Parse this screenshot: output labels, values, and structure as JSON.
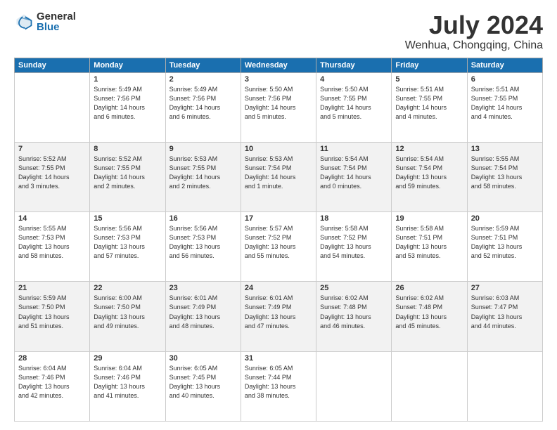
{
  "header": {
    "logo_general": "General",
    "logo_blue": "Blue",
    "month_title": "July 2024",
    "location": "Wenhua, Chongqing, China"
  },
  "days_of_week": [
    "Sunday",
    "Monday",
    "Tuesday",
    "Wednesday",
    "Thursday",
    "Friday",
    "Saturday"
  ],
  "weeks": [
    [
      {
        "day": "",
        "detail": ""
      },
      {
        "day": "1",
        "detail": "Sunrise: 5:49 AM\nSunset: 7:56 PM\nDaylight: 14 hours\nand 6 minutes."
      },
      {
        "day": "2",
        "detail": "Sunrise: 5:49 AM\nSunset: 7:56 PM\nDaylight: 14 hours\nand 6 minutes."
      },
      {
        "day": "3",
        "detail": "Sunrise: 5:50 AM\nSunset: 7:56 PM\nDaylight: 14 hours\nand 5 minutes."
      },
      {
        "day": "4",
        "detail": "Sunrise: 5:50 AM\nSunset: 7:55 PM\nDaylight: 14 hours\nand 5 minutes."
      },
      {
        "day": "5",
        "detail": "Sunrise: 5:51 AM\nSunset: 7:55 PM\nDaylight: 14 hours\nand 4 minutes."
      },
      {
        "day": "6",
        "detail": "Sunrise: 5:51 AM\nSunset: 7:55 PM\nDaylight: 14 hours\nand 4 minutes."
      }
    ],
    [
      {
        "day": "7",
        "detail": "Sunrise: 5:52 AM\nSunset: 7:55 PM\nDaylight: 14 hours\nand 3 minutes."
      },
      {
        "day": "8",
        "detail": "Sunrise: 5:52 AM\nSunset: 7:55 PM\nDaylight: 14 hours\nand 2 minutes."
      },
      {
        "day": "9",
        "detail": "Sunrise: 5:53 AM\nSunset: 7:55 PM\nDaylight: 14 hours\nand 2 minutes."
      },
      {
        "day": "10",
        "detail": "Sunrise: 5:53 AM\nSunset: 7:54 PM\nDaylight: 14 hours\nand 1 minute."
      },
      {
        "day": "11",
        "detail": "Sunrise: 5:54 AM\nSunset: 7:54 PM\nDaylight: 14 hours\nand 0 minutes."
      },
      {
        "day": "12",
        "detail": "Sunrise: 5:54 AM\nSunset: 7:54 PM\nDaylight: 13 hours\nand 59 minutes."
      },
      {
        "day": "13",
        "detail": "Sunrise: 5:55 AM\nSunset: 7:54 PM\nDaylight: 13 hours\nand 58 minutes."
      }
    ],
    [
      {
        "day": "14",
        "detail": "Sunrise: 5:55 AM\nSunset: 7:53 PM\nDaylight: 13 hours\nand 58 minutes."
      },
      {
        "day": "15",
        "detail": "Sunrise: 5:56 AM\nSunset: 7:53 PM\nDaylight: 13 hours\nand 57 minutes."
      },
      {
        "day": "16",
        "detail": "Sunrise: 5:56 AM\nSunset: 7:53 PM\nDaylight: 13 hours\nand 56 minutes."
      },
      {
        "day": "17",
        "detail": "Sunrise: 5:57 AM\nSunset: 7:52 PM\nDaylight: 13 hours\nand 55 minutes."
      },
      {
        "day": "18",
        "detail": "Sunrise: 5:58 AM\nSunset: 7:52 PM\nDaylight: 13 hours\nand 54 minutes."
      },
      {
        "day": "19",
        "detail": "Sunrise: 5:58 AM\nSunset: 7:51 PM\nDaylight: 13 hours\nand 53 minutes."
      },
      {
        "day": "20",
        "detail": "Sunrise: 5:59 AM\nSunset: 7:51 PM\nDaylight: 13 hours\nand 52 minutes."
      }
    ],
    [
      {
        "day": "21",
        "detail": "Sunrise: 5:59 AM\nSunset: 7:50 PM\nDaylight: 13 hours\nand 51 minutes."
      },
      {
        "day": "22",
        "detail": "Sunrise: 6:00 AM\nSunset: 7:50 PM\nDaylight: 13 hours\nand 49 minutes."
      },
      {
        "day": "23",
        "detail": "Sunrise: 6:01 AM\nSunset: 7:49 PM\nDaylight: 13 hours\nand 48 minutes."
      },
      {
        "day": "24",
        "detail": "Sunrise: 6:01 AM\nSunset: 7:49 PM\nDaylight: 13 hours\nand 47 minutes."
      },
      {
        "day": "25",
        "detail": "Sunrise: 6:02 AM\nSunset: 7:48 PM\nDaylight: 13 hours\nand 46 minutes."
      },
      {
        "day": "26",
        "detail": "Sunrise: 6:02 AM\nSunset: 7:48 PM\nDaylight: 13 hours\nand 45 minutes."
      },
      {
        "day": "27",
        "detail": "Sunrise: 6:03 AM\nSunset: 7:47 PM\nDaylight: 13 hours\nand 44 minutes."
      }
    ],
    [
      {
        "day": "28",
        "detail": "Sunrise: 6:04 AM\nSunset: 7:46 PM\nDaylight: 13 hours\nand 42 minutes."
      },
      {
        "day": "29",
        "detail": "Sunrise: 6:04 AM\nSunset: 7:46 PM\nDaylight: 13 hours\nand 41 minutes."
      },
      {
        "day": "30",
        "detail": "Sunrise: 6:05 AM\nSunset: 7:45 PM\nDaylight: 13 hours\nand 40 minutes."
      },
      {
        "day": "31",
        "detail": "Sunrise: 6:05 AM\nSunset: 7:44 PM\nDaylight: 13 hours\nand 38 minutes."
      },
      {
        "day": "",
        "detail": ""
      },
      {
        "day": "",
        "detail": ""
      },
      {
        "day": "",
        "detail": ""
      }
    ]
  ]
}
